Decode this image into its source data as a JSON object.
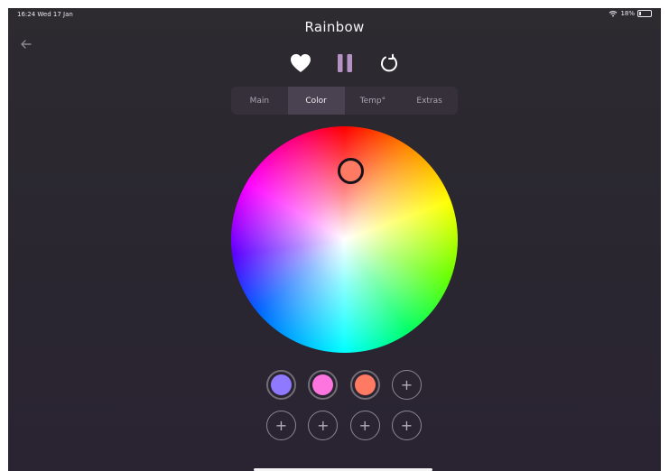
{
  "status_bar": {
    "time_date": "16:24  Wed 17 Jan",
    "battery": "18%",
    "battery_level": 0.18,
    "wifi_icon": "wifi-icon",
    "battery_icon": "battery-icon"
  },
  "header": {
    "title": "Rainbow",
    "back_icon": "back-arrow-icon"
  },
  "controls": {
    "favorite_icon": "heart-icon",
    "pause_icon": "pause-icon",
    "reset_icon": "refresh-icon"
  },
  "tabs": [
    {
      "label": "Main",
      "active": false
    },
    {
      "label": "Color",
      "active": true
    },
    {
      "label": "Temp°",
      "active": false
    },
    {
      "label": "Extras",
      "active": false
    }
  ],
  "swatches": {
    "saved": [
      {
        "color": "#8f79ff"
      },
      {
        "color": "#ff75e0"
      },
      {
        "color": "#ff7a62"
      }
    ],
    "add_symbol": "+"
  },
  "colors": {
    "accent": "#ff7a62",
    "background": "#2b2831",
    "tab_active": "#4a4250"
  }
}
